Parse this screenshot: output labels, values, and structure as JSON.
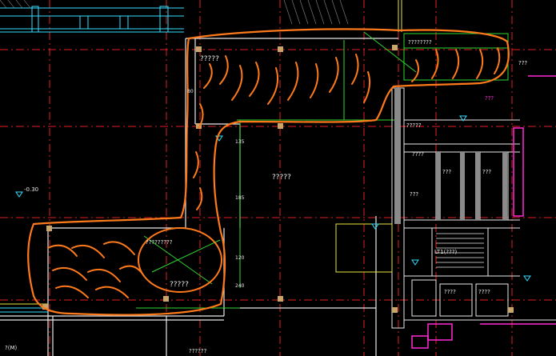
{
  "drawing": {
    "room_main": "?????",
    "room_north": "?????",
    "room_south": "?????",
    "note_right": "????????",
    "note_left": "?????????",
    "dim_a": "135",
    "dim_b": "185",
    "dim_c": "120",
    "dim_d": "240",
    "dim_e": "80",
    "level_left": "-0.30",
    "room_right_1": "?????",
    "room_right_2": "???",
    "room_right_3": "???",
    "room_right_4": "???",
    "room_right_5": "????",
    "room_right_6": "????",
    "room_right_7": "????",
    "stair_label": "LT1(???)",
    "label_bottom_left": "?(M)",
    "label_bottom_mid": "??????",
    "label_top_right": "???",
    "label_right_side": "???"
  },
  "colors": {
    "background": "#000000",
    "axis_red": "#e02020",
    "wall_cyan": "#35e0ff",
    "wall_white": "#e8e8e8",
    "green_line": "#2fd62f",
    "orange_markup": "#ff7a1a",
    "magenta": "#ff2bd6",
    "yellow": "#e7e337",
    "column_tan": "#c9a46b"
  }
}
